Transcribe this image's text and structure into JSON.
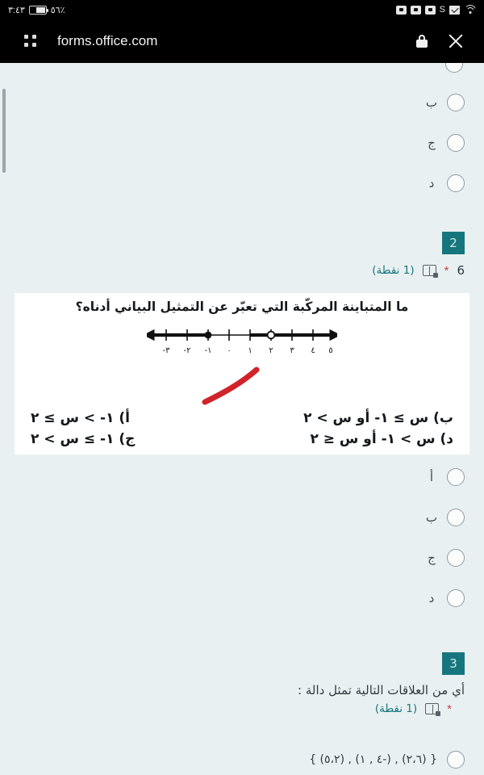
{
  "statusbar": {
    "time": "٣:٤٣",
    "battery_percent": "٥٦٪",
    "signal_letter": "S"
  },
  "browser": {
    "url": "forms.office.com"
  },
  "question1_tail": {
    "options": [
      {
        "label": "ب"
      },
      {
        "label": "ج"
      },
      {
        "label": "د"
      }
    ]
  },
  "question2": {
    "number": "2",
    "title": "6",
    "required_marker": "*",
    "points": "(1 نقطة)",
    "image": {
      "prompt": "ما المتباينة المركّبة التي تعبّر عن التمثيل البياني أدناه؟",
      "numberline": {
        "ticks": [
          "٣-",
          "٢-",
          "١-",
          "٠",
          "١",
          "٢",
          "٣",
          "٤",
          "٥"
        ],
        "closed_point": "١-",
        "open_point": "٢"
      },
      "choices": [
        {
          "key": "أ)",
          "text": "أ) ١- > س ≥ ٢"
        },
        {
          "key": "ب)",
          "text": "ب) س ≥ ١- أو س > ٢"
        },
        {
          "key": "ج)",
          "text": "ج) ١- ≥ س > ٢"
        },
        {
          "key": "د)",
          "text": "د) س > ١- أو س ≤ ٢"
        }
      ]
    },
    "options": [
      {
        "label": "أ"
      },
      {
        "label": "ب"
      },
      {
        "label": "ج"
      },
      {
        "label": "د"
      }
    ]
  },
  "question3": {
    "number": "3",
    "title": "أي من العلاقات التالية تمثل دالة :",
    "required_marker": "*",
    "points": "(1 نقطة)",
    "options": [
      {
        "label": "{ (٥،٢) , (٤ , ١-) , (٢،٦) }"
      }
    ]
  },
  "colors": {
    "accent_teal": "#17767d",
    "page_bg": "#e9f0f1",
    "required_red": "#c94040",
    "annotation_red": "#d0242a"
  }
}
